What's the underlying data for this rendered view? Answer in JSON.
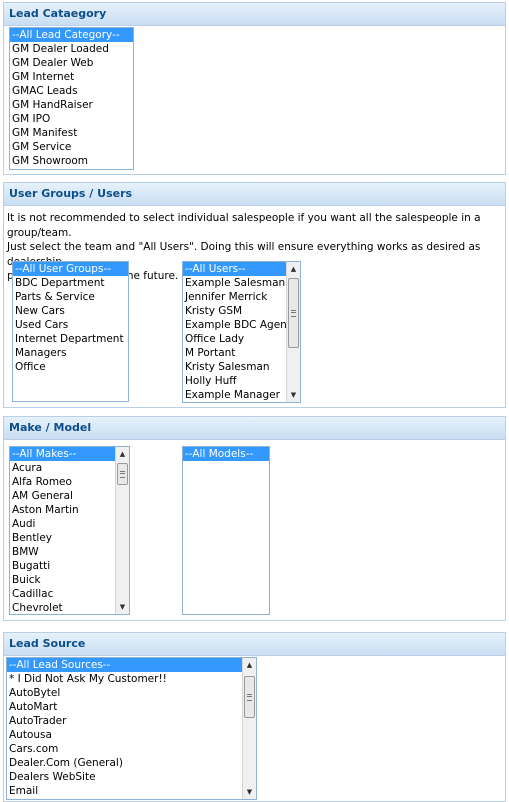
{
  "lead_category": {
    "title": "Lead Cataegory",
    "options": [
      "--All Lead Category--",
      "GM Dealer Loaded",
      "GM Dealer Web",
      "GM Internet",
      "GMAC Leads",
      "GM HandRaiser",
      "GM IPO",
      "GM Manifest",
      "GM Service",
      "GM Showroom"
    ],
    "selected_index": 0
  },
  "user_groups": {
    "title": "User Groups / Users",
    "note_line1": "It is not recommended to select individual salespeople if you want all the salespeople in a group/team.",
    "note_line2": "Just select the team and \"All Users\". Doing this will ensure everything works as desired as dealership",
    "note_line3": "personnel changes in the future.",
    "groups": [
      "--All User Groups--",
      "BDC Department",
      "Parts & Service",
      "New Cars",
      "Used Cars",
      "Internet Department",
      "Managers",
      "Office"
    ],
    "users": [
      "--All Users--",
      "Example Salesman",
      "Jennifer Merrick",
      "Kristy GSM",
      "Example BDC Agent",
      "Office Lady",
      "M Portant",
      "Kristy Salesman",
      "Holly Huff",
      "Example Manager"
    ]
  },
  "make_model": {
    "title": "Make / Model",
    "makes": [
      "--All Makes--",
      "Acura",
      "Alfa Romeo",
      "AM General",
      "Aston Martin",
      "Audi",
      "Bentley",
      "BMW",
      "Bugatti",
      "Buick",
      "Cadillac",
      "Chevrolet"
    ],
    "models": [
      "--All Models--"
    ]
  },
  "lead_source": {
    "title": "Lead Source",
    "options": [
      "--All Lead Sources--",
      "* I Did Not Ask My Customer!!",
      "AutoBytel",
      "AutoMart",
      "AutoTrader",
      "Autousa",
      "Cars.com",
      "Dealer.Com (General)",
      "Dealers WebSite",
      "Email"
    ]
  },
  "icons": {
    "scroll_up": "▲",
    "scroll_down": "▼"
  },
  "colors": {
    "header_text": "#0c4f8a",
    "selection": "#3399ff",
    "panel_border": "#b8cfe6"
  }
}
